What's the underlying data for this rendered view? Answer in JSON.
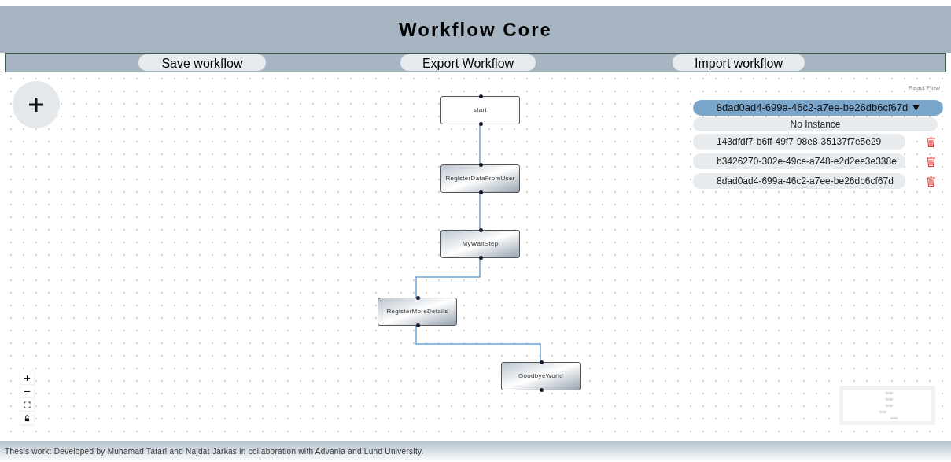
{
  "header": {
    "title": "Workflow Core"
  },
  "toolbar": {
    "buttons": [
      "Save workflow",
      "Export Workflow",
      "Import workflow"
    ]
  },
  "canvas": {
    "attribution": "React Flow",
    "nodes": [
      {
        "label": "start",
        "kind": "start"
      },
      {
        "label": "RegisterDataFromUser",
        "kind": "step"
      },
      {
        "label": "MyWaitStep",
        "kind": "step"
      },
      {
        "label": "RegisterMoreDetails",
        "kind": "step"
      },
      {
        "label": "GoodbyeWorld",
        "kind": "step"
      }
    ]
  },
  "instance_picker": {
    "value": "8dad0ad4-699a-46c2-a7ee-be26db6cf67d",
    "options": [
      {
        "label": "No Instance",
        "kind": "empty"
      },
      {
        "label": "143dfdf7-b6ff-49f7-98e8-35137f7e5e29",
        "kind": "instance"
      },
      {
        "label": "b3426270-302e-49ce-a748-e2d2ee3e338e",
        "kind": "instance"
      },
      {
        "label": "8dad0ad4-699a-46c2-a7ee-be26db6cf67d",
        "kind": "instance"
      }
    ]
  },
  "footer": {
    "text": "Thesis work: Developed by Muhamad Tatari and Najdat Jarkas in collaboration with Advania and Lund University."
  }
}
